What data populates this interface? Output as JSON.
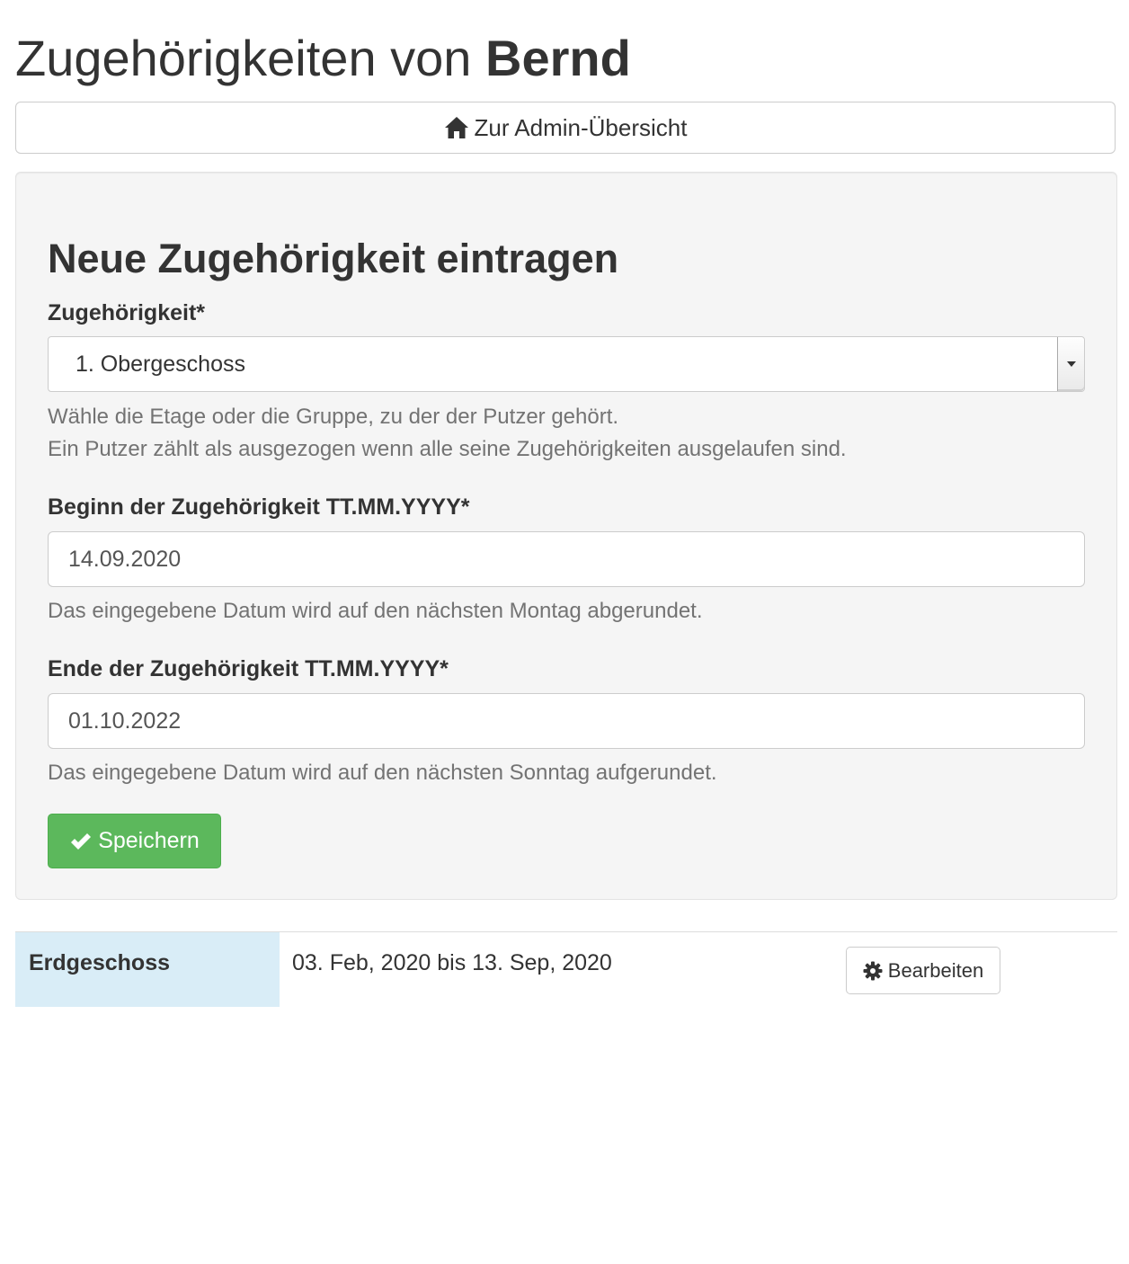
{
  "header": {
    "title_prefix": "Zugehörigkeiten von",
    "title_name": "Bernd"
  },
  "nav": {
    "admin_link_label": "Zur Admin-Übersicht",
    "admin_link_icon": "home-icon"
  },
  "form": {
    "title": "Neue Zugehörigkeit eintragen",
    "group_field": {
      "label": "Zugehörigkeit*",
      "selected_value": "1. Obergeschoss",
      "help_line1": "Wähle die Etage oder die Gruppe, zu der der Putzer gehört.",
      "help_line2": "Ein Putzer zählt als ausgezogen wenn alle seine Zugehörigkeiten ausgelaufen sind."
    },
    "start_field": {
      "label": "Beginn der Zugehörigkeit TT.MM.YYYY*",
      "value": "14.09.2020",
      "help": "Das eingegebene Datum wird auf den nächsten Montag abgerundet."
    },
    "end_field": {
      "label": "Ende der Zugehörigkeit TT.MM.YYYY*",
      "value": "01.10.2022",
      "help": "Das eingegebene Datum wird auf den nächsten Sonntag aufgerundet."
    },
    "save_label": "Speichern",
    "save_icon": "checkmark-icon"
  },
  "memberships": [
    {
      "group": "Erdgeschoss",
      "range": "03. Feb, 2020 bis 13. Sep, 2020",
      "edit_label": "Bearbeiten",
      "edit_icon": "gear-icon"
    }
  ],
  "colors": {
    "success": "#5cb85c",
    "info_row": "#d9edf7",
    "well": "#f5f5f5",
    "text": "#333333",
    "muted": "#737373"
  }
}
